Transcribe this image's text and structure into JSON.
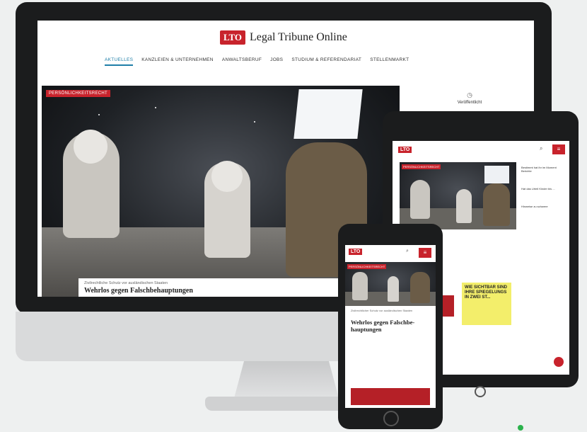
{
  "site": {
    "logo_mark": "LTO",
    "name": "Legal Tribune Online",
    "nav": [
      {
        "label": "AKTUELLES"
      },
      {
        "label": "KANZLEIEN & UNTERNEHMEN"
      },
      {
        "label": "ANWALTSBERUF"
      },
      {
        "label": "JOBS"
      },
      {
        "label": "STUDIUM & REFERENDARIAT"
      },
      {
        "label": "STELLENMARKT"
      }
    ]
  },
  "hero": {
    "tag": "PERSÖNLICHKEITSRECHT",
    "kicker": "Zivilrechtliche Schutz vor ausländischen Staaten",
    "headline": "Wehrlos gegen Falschbehauptungen"
  },
  "sidebar": {
    "icon": "clock-icon",
    "label": "Veröffentlicht"
  },
  "tablet": {
    "logo_mark": "LTO",
    "tag": "PERSÖNLICHKEITSRECHT",
    "ad_text": "WIE SICHTBAR SIND IHRE SPIEGELUNGS IN ZWEI ST...",
    "side_texts": [
      "Bestimmt hat ihr im Moment Berichte",
      "Hat das Urteil Kinder bis ...",
      "Hinweise zu schwere"
    ]
  },
  "phone": {
    "logo_mark": "LTO",
    "tag": "PERSÖNLICHKEITSRECHT",
    "kicker": "Zivilrechtlicher Schutz vor ausländischen Staaten",
    "headline": "Wehrlos gegen Falschbe­hauptungen"
  },
  "colors": {
    "brand": "#c8232c",
    "nav_active": "#1f7fa8",
    "ad": "#f3ee6b"
  }
}
